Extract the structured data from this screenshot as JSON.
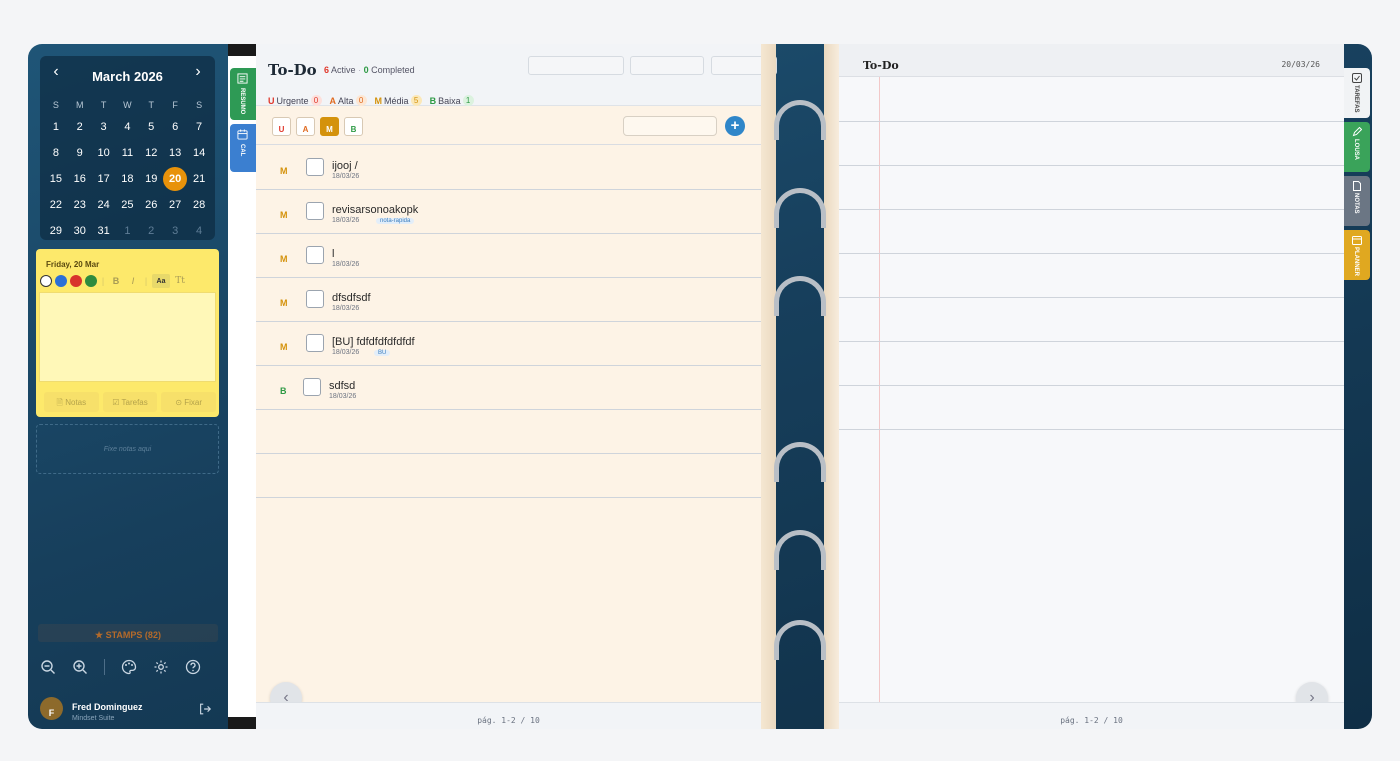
{
  "calendar": {
    "title": "March 2026",
    "weekdays": [
      "S",
      "M",
      "T",
      "W",
      "T",
      "F",
      "S"
    ],
    "days": [
      {
        "d": "1",
        "m": false
      },
      {
        "d": "2",
        "m": false
      },
      {
        "d": "3",
        "m": false
      },
      {
        "d": "4",
        "m": false
      },
      {
        "d": "5",
        "m": false
      },
      {
        "d": "6",
        "m": false
      },
      {
        "d": "7",
        "m": false
      },
      {
        "d": "8",
        "m": false
      },
      {
        "d": "9",
        "m": false
      },
      {
        "d": "10",
        "m": false
      },
      {
        "d": "11",
        "m": false
      },
      {
        "d": "12",
        "m": false
      },
      {
        "d": "13",
        "m": false
      },
      {
        "d": "14",
        "m": false
      },
      {
        "d": "15",
        "m": false
      },
      {
        "d": "16",
        "m": false
      },
      {
        "d": "17",
        "m": false
      },
      {
        "d": "18",
        "m": false
      },
      {
        "d": "19",
        "m": false
      },
      {
        "d": "20",
        "m": false,
        "today": true
      },
      {
        "d": "21",
        "m": false
      },
      {
        "d": "22",
        "m": false
      },
      {
        "d": "23",
        "m": false
      },
      {
        "d": "24",
        "m": false
      },
      {
        "d": "25",
        "m": false
      },
      {
        "d": "26",
        "m": false
      },
      {
        "d": "27",
        "m": false
      },
      {
        "d": "28",
        "m": false
      },
      {
        "d": "29",
        "m": false
      },
      {
        "d": "30",
        "m": false
      },
      {
        "d": "31",
        "m": false
      },
      {
        "d": "1",
        "m": true
      },
      {
        "d": "2",
        "m": true
      },
      {
        "d": "3",
        "m": true
      },
      {
        "d": "4",
        "m": true
      }
    ]
  },
  "note": {
    "date": "Friday, 20 Mar",
    "colors": [
      "#ffffff",
      "#2b6fd6",
      "#d8332c",
      "#2e8b3e"
    ],
    "bold": "B",
    "italic": "I",
    "font_size": "Aa",
    "font": "Tt",
    "actions": [
      "Notas",
      "Tarefas",
      "Fixar"
    ]
  },
  "pin_area": "Fixe notas aqui",
  "stamps": "★ STAMPS (82)",
  "user": {
    "initial": "F",
    "name": "Fred Dominguez",
    "sub": "Mindset Suite"
  },
  "left_tabs": [
    {
      "label": "RESUMO",
      "color": "#2e9a55",
      "icon": "summary-icon"
    },
    {
      "label": "CAL",
      "color": "#3b7fd0",
      "icon": "calendar-icon"
    }
  ],
  "todo": {
    "title": "To-Do",
    "active_count": "6",
    "active_label": "Active",
    "sep": "·",
    "completed_count": "0",
    "completed_label": "Completed",
    "priorities": [
      {
        "letter": "U",
        "label": "Urgente",
        "count": "0",
        "color": "#e0382c",
        "bg": "#fde0dc"
      },
      {
        "letter": "A",
        "label": "Alta",
        "count": "0",
        "color": "#e06a20",
        "bg": "#fde7d4"
      },
      {
        "letter": "M",
        "label": "Média",
        "count": "5",
        "color": "#d4920c",
        "bg": "#fbe8b8"
      },
      {
        "letter": "B",
        "label": "Baixa",
        "count": "1",
        "color": "#2e9a45",
        "bg": "#dcf2df"
      }
    ],
    "filters": [
      "U",
      "A",
      "M",
      "B"
    ],
    "add": "+",
    "tasks": [
      {
        "p": "M",
        "color": "#d4920c",
        "title": "ijooj /",
        "date": "18/03/26",
        "tag": ""
      },
      {
        "p": "M",
        "color": "#d4920c",
        "title": "revisarsonoakopk",
        "date": "18/03/26",
        "tag": "nota-rapida"
      },
      {
        "p": "M",
        "color": "#d4920c",
        "title": "l",
        "date": "18/03/26",
        "tag": ""
      },
      {
        "p": "M",
        "color": "#d4920c",
        "title": "dfsdfsdf",
        "date": "18/03/26",
        "tag": ""
      },
      {
        "p": "M",
        "color": "#d4920c",
        "title": "[BU] fdfdfdfdfdfdf",
        "date": "18/03/26",
        "tag": "BU"
      },
      {
        "p": "B",
        "color": "#2e9a45",
        "title": "sdfsd",
        "date": "18/03/26",
        "tag": ""
      }
    ],
    "footer": "pág. 1-2 / 10"
  },
  "right_page": {
    "title": "To-Do",
    "date": "20/03/26",
    "footer": "pág. 1-2 / 10"
  },
  "right_tabs": [
    {
      "label": "TAREFAS",
      "color": "#f1f3f5",
      "text": "#444",
      "icon": "checklist-icon"
    },
    {
      "label": "LOUSA",
      "color": "#3aa35a",
      "text": "#fff",
      "icon": "pen-icon"
    },
    {
      "label": "NOTAS",
      "color": "#6b7684",
      "text": "#fff",
      "icon": "document-icon"
    },
    {
      "label": "PLANNER",
      "color": "#e0a820",
      "text": "#fff",
      "icon": "planner-icon"
    }
  ]
}
